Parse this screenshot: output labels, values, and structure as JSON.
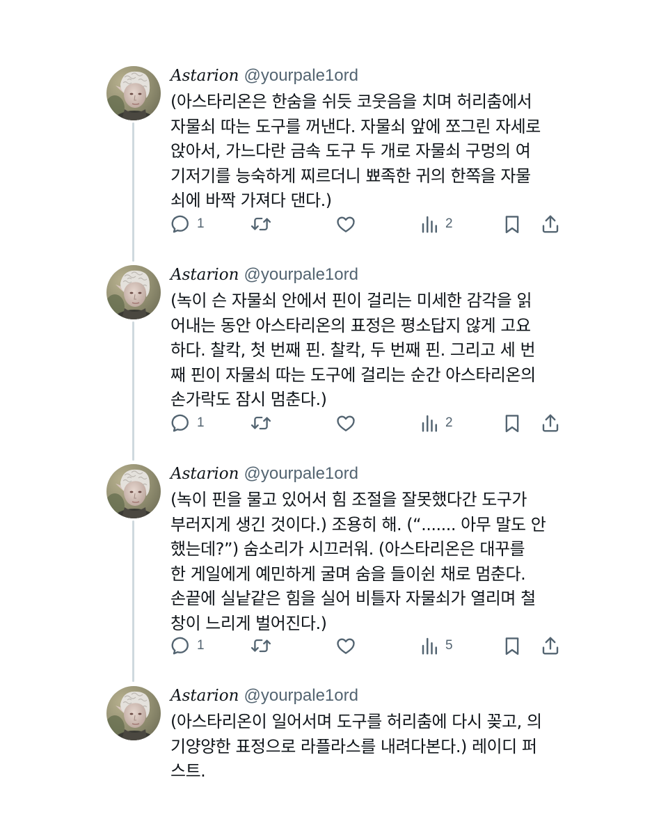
{
  "tweets": [
    {
      "name": "Astarion",
      "handle": "@yourpale1ord",
      "lines": [
        "(아스타리온은 한숨을 쉬듯 코웃음을 치며 허리춤에서",
        "자물쇠 따는 도구를 꺼낸다. 자물쇠 앞에 쪼그린 자세로",
        "앉아서, 가느다란 금속 도구 두 개로 자물쇠 구멍의 여",
        "기저기를 능숙하게 찌르더니 뾰족한 귀의 한쪽을 자물",
        "쇠에 바짝 가져다 댄다.)"
      ],
      "reply_count": "1",
      "retweet_count": "",
      "like_count": "",
      "view_count": "2"
    },
    {
      "name": "Astarion",
      "handle": "@yourpale1ord",
      "lines": [
        "(녹이 슨 자물쇠 안에서 핀이 걸리는 미세한 감각을 읽",
        "어내는 동안 아스타리온의 표정은 평소답지 않게 고요",
        "하다. 찰칵, 첫 번째 핀. 찰칵, 두 번째 핀. 그리고 세 번",
        "째 핀이 자물쇠 따는 도구에 걸리는 순간 아스타리온의",
        "손가락도 잠시 멈춘다.)"
      ],
      "reply_count": "1",
      "retweet_count": "",
      "like_count": "",
      "view_count": "2"
    },
    {
      "name": "Astarion",
      "handle": "@yourpale1ord",
      "lines": [
        "(녹이 핀을 물고 있어서 힘 조절을 잘못했다간 도구가",
        "부러지게 생긴 것이다.) 조용히 해. (“....... 아무 말도 안",
        "했는데?”) 숨소리가 시끄러워. (아스타리온은 대꾸를",
        "한 게일에게 예민하게 굴며 숨을 들이쉰 채로 멈춘다.",
        "손끝에 실낱같은 힘을 실어 비틀자 자물쇠가 열리며 철",
        "창이 느리게 벌어진다.)"
      ],
      "reply_count": "1",
      "retweet_count": "",
      "like_count": "",
      "view_count": "5"
    },
    {
      "name": "Astarion",
      "handle": "@yourpale1ord",
      "lines": [
        "(아스타리온이 일어서며 도구를 허리춤에 다시 꽂고, 의",
        "기양양한 표정으로 라플라스를 내려다본다.) 레이디 퍼",
        "스트."
      ]
    }
  ],
  "icons": {
    "reply": "speech-bubble-icon",
    "retweet": "retweet-arrows-icon",
    "like": "heart-icon",
    "views": "bar-chart-icon",
    "bookmark": "bookmark-icon",
    "share": "share-upload-icon"
  },
  "colors": {
    "text": "#0f1419",
    "secondary": "#536471",
    "thread_line": "#cfd9de",
    "background": "#ffffff"
  }
}
